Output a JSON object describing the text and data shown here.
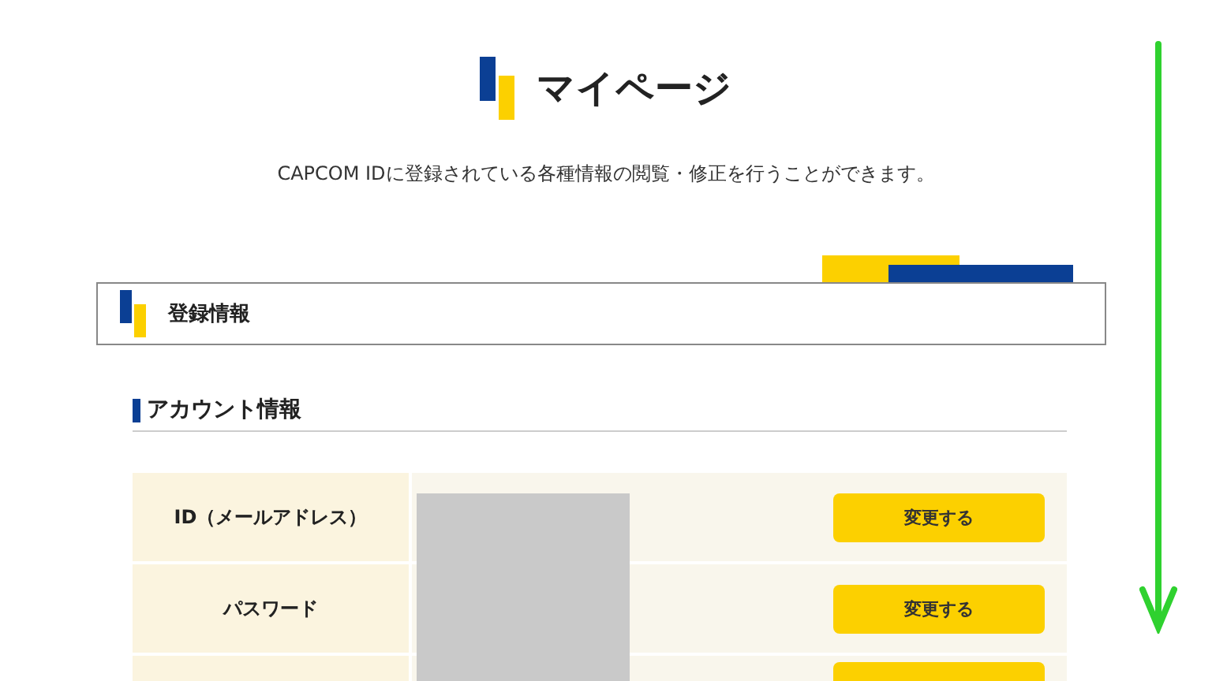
{
  "page": {
    "title": "マイページ",
    "description": "CAPCOM IDに登録されている各種情報の閲覧・修正を行うことができます。"
  },
  "section": {
    "title": "登録情報"
  },
  "account": {
    "heading": "アカウント情報",
    "rows": [
      {
        "label": "ID（メールアドレス）",
        "button": "変更する"
      },
      {
        "label": "パスワード",
        "button": "変更する"
      },
      {
        "kind": "partial"
      }
    ]
  }
}
